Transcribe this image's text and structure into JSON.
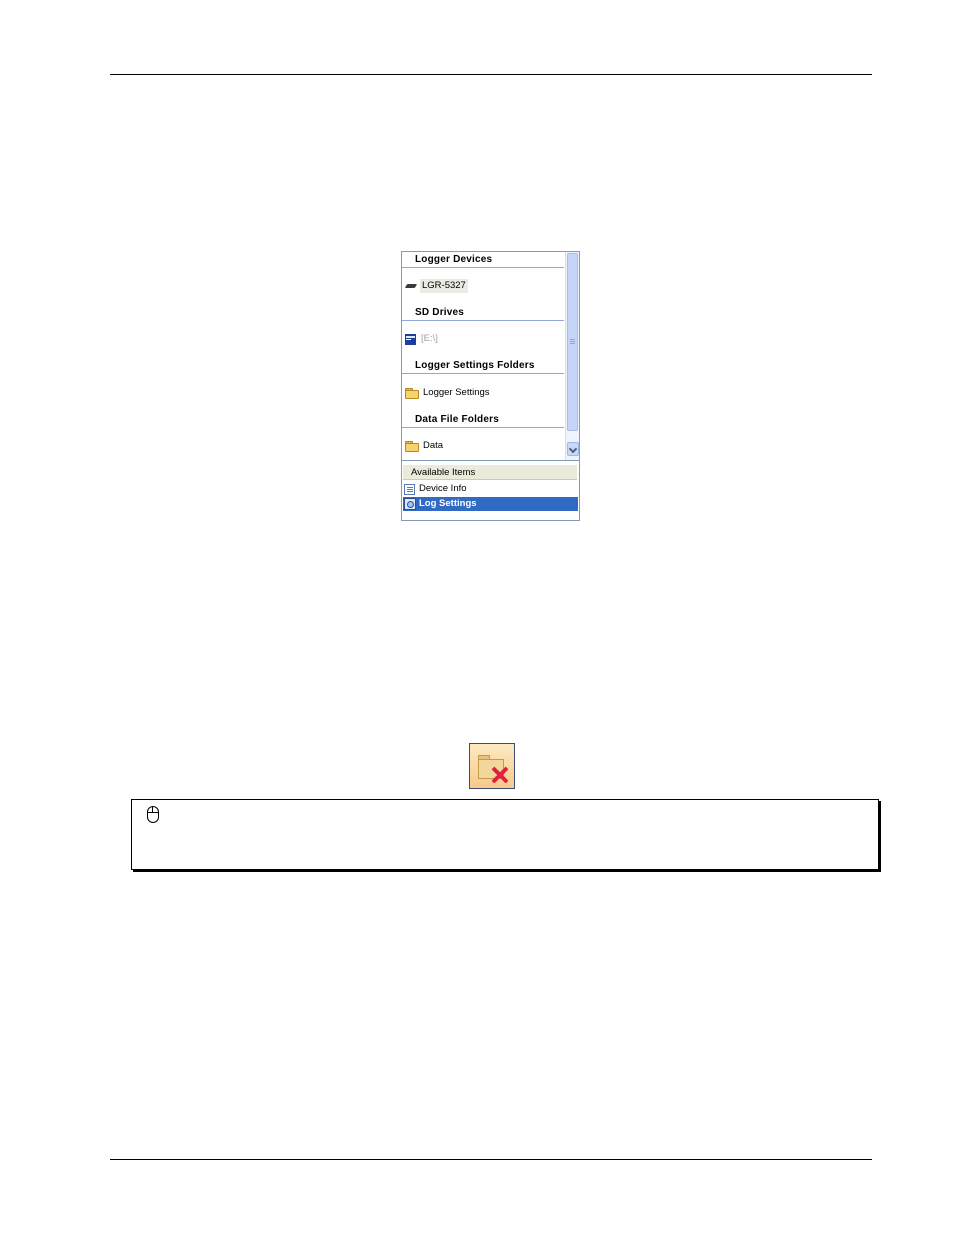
{
  "panel": {
    "sections": [
      {
        "header": "Logger Devices",
        "item": "LGR-5327",
        "icon": "device-icon"
      },
      {
        "header": "SD Drives",
        "item": "[E:\\]",
        "icon": "sd-card-icon"
      },
      {
        "header": "Logger Settings Folders",
        "item": "Logger Settings",
        "icon": "folder-icon"
      },
      {
        "header": "Data File Folders",
        "item": "Data",
        "icon": "folder-icon"
      }
    ],
    "available_items": {
      "header": "Available Items",
      "items": [
        {
          "label": "Device Info",
          "icon": "list-icon"
        },
        {
          "label": "Log Settings",
          "icon": "log-settings-icon"
        }
      ]
    }
  },
  "delete_button": {
    "icon": "delete-folder-icon"
  },
  "note": {
    "icon": "mouse-icon"
  },
  "colors": {
    "selection": "#316ac5",
    "header_rule": "#93a7d9",
    "delete_x": "#e0203d"
  }
}
